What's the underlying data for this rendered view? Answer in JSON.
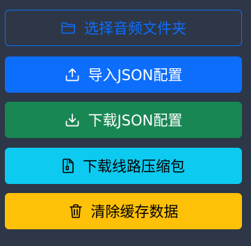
{
  "buttons": {
    "select_folder": {
      "label": "选择音频文件夹",
      "icon": "folder-icon"
    },
    "import_json": {
      "label": "导入JSON配置",
      "icon": "upload-icon"
    },
    "download_json": {
      "label": "下载JSON配置",
      "icon": "download-icon"
    },
    "download_zip": {
      "label": "下载线路压缩包",
      "icon": "file-zip-icon"
    },
    "clear_cache": {
      "label": "清除缓存数据",
      "icon": "trash-icon"
    }
  },
  "colors": {
    "background": "#2d3748",
    "primary": "#0d6efd",
    "success": "#198754",
    "info": "#0dcaf0",
    "warning": "#ffc107"
  }
}
